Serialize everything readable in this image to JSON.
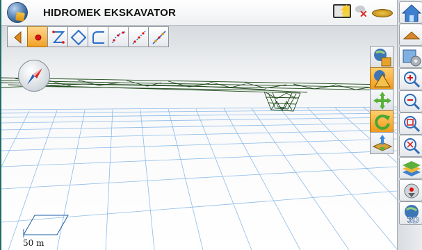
{
  "app": {
    "title": "HIDROMEK EKSKAVATOR",
    "app_icon": "globe-excavator-icon"
  },
  "status_bar": {
    "icons": [
      "battery-charging-icon",
      "gps-no-signal-icon",
      "level-bubble-icon"
    ]
  },
  "draw_toolbar": {
    "items": [
      {
        "icon": "arrow-left-icon",
        "selected": false
      },
      {
        "icon": "point-icon",
        "selected": true
      },
      {
        "icon": "polyline-icon",
        "selected": false
      },
      {
        "icon": "polygon-icon",
        "selected": false
      },
      {
        "icon": "arc-icon",
        "selected": false
      },
      {
        "icon": "curve-points-icon",
        "selected": false
      },
      {
        "icon": "line-points-icon",
        "selected": false
      },
      {
        "icon": "line-segment-icon",
        "selected": false
      }
    ]
  },
  "view_toolbar": {
    "items": [
      {
        "icon": "globe-view-icon",
        "selected": false
      },
      {
        "icon": "terrain-view-icon",
        "selected": true
      },
      {
        "icon": "pan-icon",
        "selected": false
      },
      {
        "icon": "rotate-icon",
        "selected": true
      },
      {
        "icon": "layer-elevation-icon",
        "selected": false
      }
    ]
  },
  "right_panel": {
    "items": [
      {
        "icon": "home-icon"
      },
      {
        "icon": "collapse-up-icon"
      },
      {
        "icon": "map-settings-icon"
      },
      {
        "icon": "zoom-in-icon"
      },
      {
        "icon": "zoom-out-icon"
      },
      {
        "icon": "zoom-window-icon"
      },
      {
        "icon": "zoom-extents-icon"
      },
      {
        "icon": "layers-icon"
      },
      {
        "icon": "center-location-icon"
      },
      {
        "icon": "view-3d-icon",
        "label": "3D"
      }
    ]
  },
  "compass": {
    "icon": "compass-icon"
  },
  "scale": {
    "label": "50 m"
  },
  "colors": {
    "accent": "#f2a128",
    "grid": "#7fb2e5",
    "terrain": "#1f4a1a"
  }
}
